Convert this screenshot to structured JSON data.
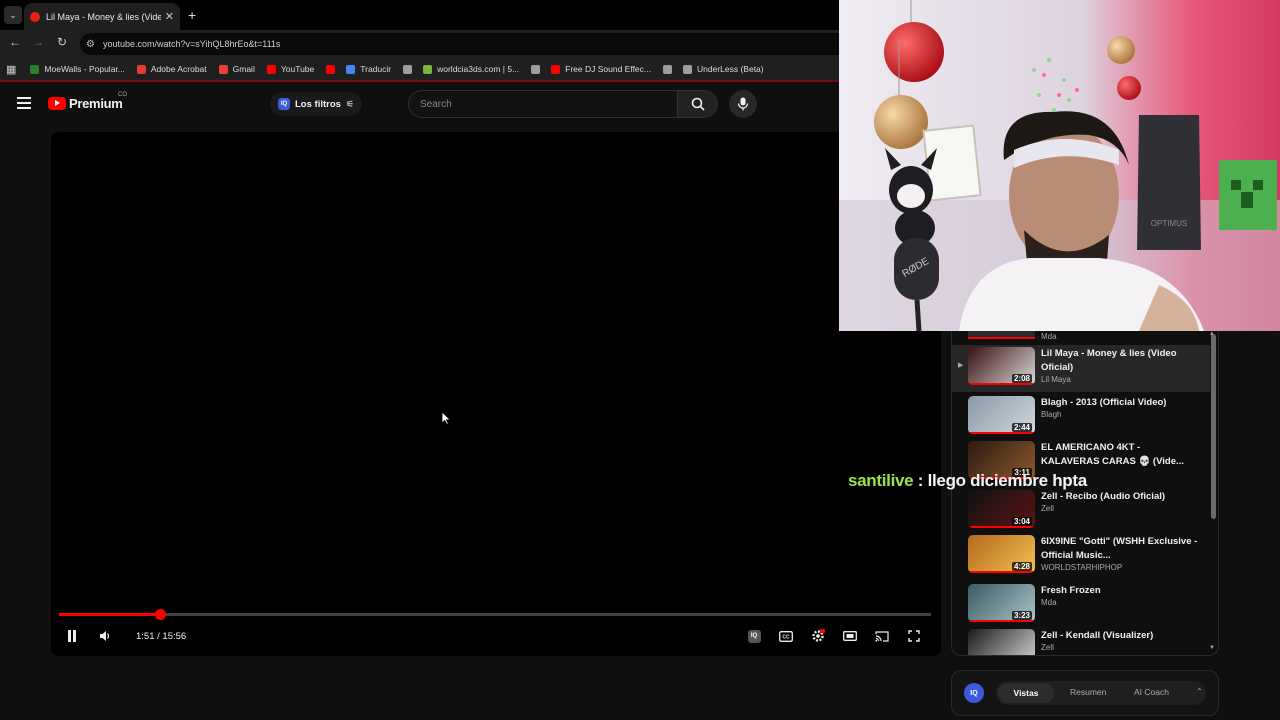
{
  "browser": {
    "tab_title": "Lil Maya - Money & lies (Video",
    "url": "youtube.com/watch?v=sYihQL8hrEo&t=111s",
    "bookmarks": [
      {
        "label": "MoeWalls - Popular...",
        "color": "#2e7d32"
      },
      {
        "label": "Adobe Acrobat",
        "color": "#e53935"
      },
      {
        "label": "Gmail",
        "color": "#ea4335"
      },
      {
        "label": "YouTube",
        "color": "#ff0000"
      },
      {
        "label": "",
        "color": "#ff0000"
      },
      {
        "label": "Traducir",
        "color": "#4285f4"
      },
      {
        "label": "",
        "color": "#9e9e9e"
      },
      {
        "label": "worldcia3ds.com | 5...",
        "color": "#7cb342"
      },
      {
        "label": "",
        "color": "#9e9e9e"
      },
      {
        "label": "Free DJ Sound Effec...",
        "color": "#ff0000"
      },
      {
        "label": "",
        "color": "#9e9e9e"
      },
      {
        "label": "UnderLess (Beta)",
        "color": "#9e9e9e"
      }
    ]
  },
  "masthead": {
    "logo_text": "Premium",
    "country": "CO",
    "filters_label": "Los filtros",
    "search_placeholder": "Search"
  },
  "player": {
    "time_current": "1:51",
    "time_total": "15:56",
    "progress_fraction": 0.116,
    "badge": "IQ"
  },
  "chat": {
    "user": "santilive",
    "separator": " : ",
    "message": "llego diciembre hpta"
  },
  "playlist": {
    "top_channel": "Mda",
    "items": [
      {
        "title": "Lil Maya - Money & lies (Video Oficial)",
        "channel": "Lil Maya",
        "duration": "2:08",
        "active": true,
        "thumb": [
          "#3a1010",
          "#d9d9d9"
        ]
      },
      {
        "title": "Blagh - 2013 (Official Video)",
        "channel": "Blagh",
        "duration": "2:44",
        "active": false,
        "thumb": [
          "#8a9aa8",
          "#d0d6dc"
        ]
      },
      {
        "title": "EL AMERICANO 4KT - KALAVERAS CARAS 💀 (Vide...",
        "channel": "",
        "duration": "3:11",
        "active": false,
        "thumb": [
          "#2b1a12",
          "#8b5a2b"
        ]
      },
      {
        "title": "Zell - Recibo (Audio Oficial)",
        "channel": "Zell",
        "duration": "3:04",
        "active": false,
        "thumb": [
          "#111",
          "#5a1414"
        ]
      },
      {
        "title": "6IX9INE \"Gotti\" (WSHH Exclusive - Official Music...",
        "channel": "WORLDSTARHIPHOP",
        "duration": "4:28",
        "active": false,
        "thumb": [
          "#b4691f",
          "#f2c14e"
        ]
      },
      {
        "title": "Fresh Frozen",
        "channel": "Mda",
        "duration": "3:23",
        "active": false,
        "thumb": [
          "#3c5a63",
          "#a9c4c8"
        ]
      },
      {
        "title": "Zell - Kendall (Visualizer)",
        "channel": "Zell",
        "duration": "",
        "active": false,
        "thumb": [
          "#1a1a1a",
          "#d8d8d8"
        ]
      }
    ]
  },
  "bottom_tabs": {
    "badge": "IQ",
    "tabs": [
      "Vistas",
      "Resumen",
      "AI Coach"
    ]
  },
  "colors": {
    "accent": "#ff0000",
    "chat_user": "#9ae34a"
  }
}
